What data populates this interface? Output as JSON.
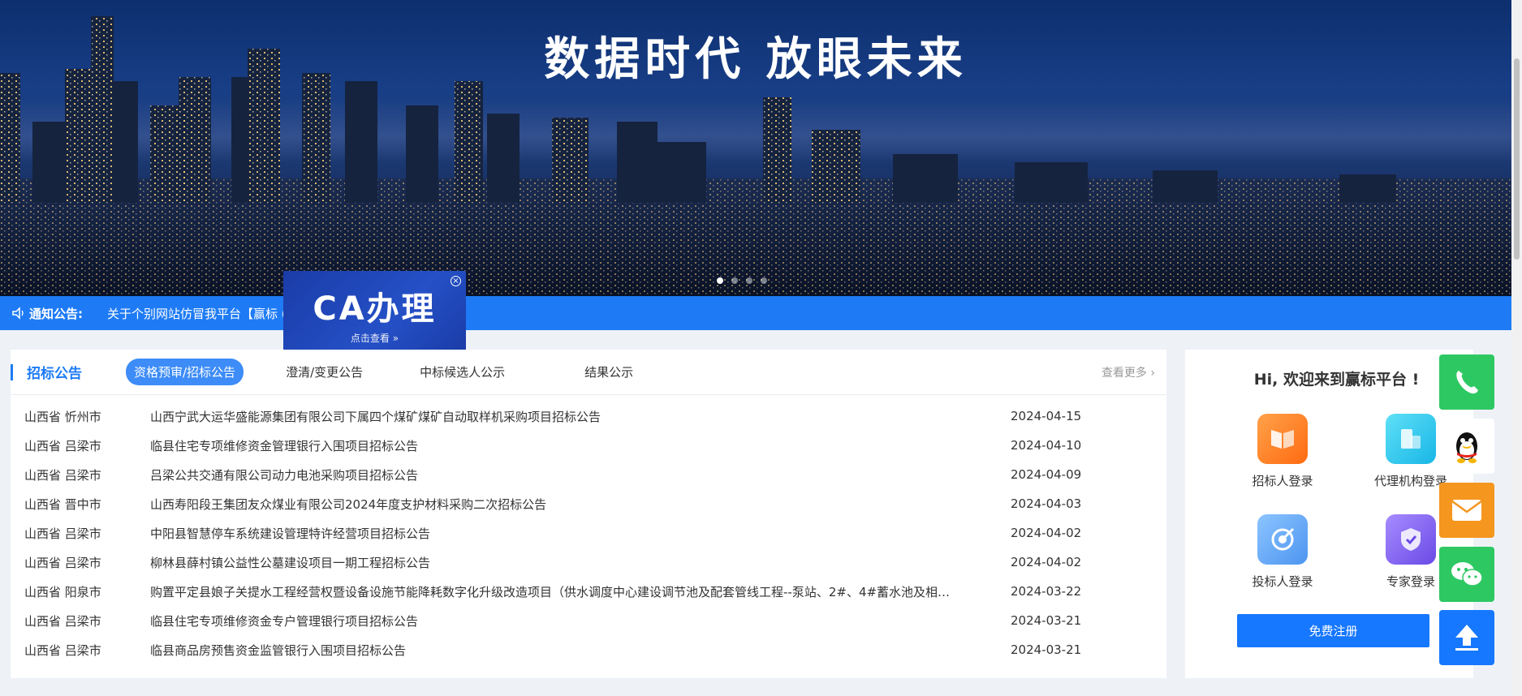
{
  "banner": {
    "title": "数据时代  放眼未来",
    "dots": 4,
    "active_dot": 0
  },
  "notice": {
    "label": "通知公告:",
    "text": "关于个别网站仿冒我平台【赢标  (                    区) 】的声明"
  },
  "ca_popup": {
    "title": "CA办理",
    "subtitle": "点击查看 »",
    "close": "×"
  },
  "bids": {
    "section_title": "招标公告",
    "tabs": [
      "资格预审/招标公告",
      "澄清/变更公告",
      "中标候选人公示",
      "结果公示"
    ],
    "active_tab": 0,
    "more": "查看更多 ›",
    "rows": [
      {
        "region": "山西省 忻州市",
        "title": "山西宁武大运华盛能源集团有限公司下属四个煤矿煤矿自动取样机采购项目招标公告",
        "date": "2024-04-15"
      },
      {
        "region": "山西省 吕梁市",
        "title": "临县住宅专项维修资金管理银行入围项目招标公告",
        "date": "2024-04-10"
      },
      {
        "region": "山西省 吕梁市",
        "title": "吕梁公共交通有限公司动力电池采购项目招标公告",
        "date": "2024-04-09"
      },
      {
        "region": "山西省 晋中市",
        "title": "山西寿阳段王集团友众煤业有限公司2024年度支护材料采购二次招标公告",
        "date": "2024-04-03"
      },
      {
        "region": "山西省 吕梁市",
        "title": "中阳县智慧停车系统建设管理特许经营项目招标公告",
        "date": "2024-04-02"
      },
      {
        "region": "山西省 吕梁市",
        "title": "柳林县薛村镇公益性公墓建设项目一期工程招标公告",
        "date": "2024-04-02"
      },
      {
        "region": "山西省 阳泉市",
        "title": "购置平定县娘子关提水工程经营权暨设备设施节能降耗数字化升级改造项目（供水调度中心建设调节池及配套管线工程--泵站、2#、4#蓄水池及相…",
        "date": "2024-03-22"
      },
      {
        "region": "山西省 吕梁市",
        "title": "临县住宅专项维修资金专户管理银行项目招标公告",
        "date": "2024-03-21"
      },
      {
        "region": "山西省 吕梁市",
        "title": "临县商品房预售资金监管银行入围项目招标公告",
        "date": "2024-03-21"
      }
    ]
  },
  "welcome": {
    "title": "Hi, 欢迎来到赢标平台 !",
    "logins": [
      {
        "label": "招标人登录",
        "icon": "tenderer-icon",
        "color": "#ff7a1a"
      },
      {
        "label": "代理机构登录",
        "icon": "agency-icon",
        "color": "#22c3ee"
      },
      {
        "label": "投标人登录",
        "icon": "bidder-icon",
        "color": "#5aa3f5"
      },
      {
        "label": "专家登录",
        "icon": "expert-icon",
        "color": "#7a5cf0"
      }
    ],
    "register": "免费注册"
  },
  "float_bar": {
    "phone_color": "#2ec862",
    "mail_color": "#f5961e",
    "wechat_color": "#2ec862",
    "top_color": "#1677ff"
  }
}
